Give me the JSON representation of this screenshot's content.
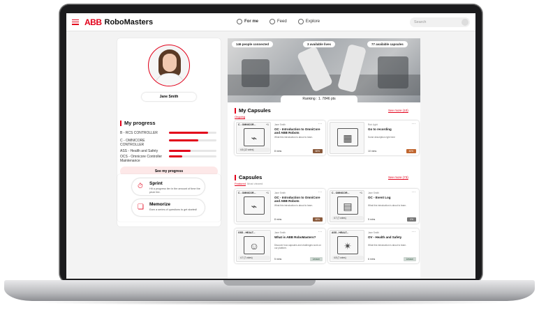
{
  "nav": {
    "logo": "ABB",
    "app_name": "RoboMasters",
    "tabs": [
      {
        "label": "For me",
        "active": true
      },
      {
        "label": "Feed",
        "active": false
      },
      {
        "label": "Explore",
        "active": false
      }
    ],
    "search_placeholder": "Search"
  },
  "profile": {
    "name": "Jane Smith",
    "progress_title": "My progress",
    "progress": [
      {
        "label": "B - RCS CONTROLLER",
        "value": 0.82
      },
      {
        "label": "C - OMNICORE CONTROLLER",
        "value": 0.62
      },
      {
        "label": "ASS - Health and Safety",
        "value": 0.45
      },
      {
        "label": "OCS - Omnicore Controller Maintenance",
        "value": 0.28
      }
    ],
    "see_progress": "See my progress"
  },
  "activities": [
    {
      "title": "Sprint",
      "desc": "Hit a progress tier in the amount of time the prize fee."
    },
    {
      "title": "Memorize",
      "desc": "Earn a series of questions to get started!"
    }
  ],
  "hero": {
    "connected": "146 people connected",
    "lives": "3 available lives",
    "capsules_avail": "77 available capsules",
    "ranking": "Ranking : 1.  7846 pts"
  },
  "my_capsules": {
    "title": "My Capsules",
    "see_more": "See more (10)",
    "tab": "Ongoing",
    "items": [
      {
        "code": "C - OMNICOR...",
        "count": "+1",
        "by": "Jane Smith",
        "title": "OC - Introduction to OmniCore and ABB Robots",
        "desc": "What this introduction is about to learn.",
        "rating": "4.6 (12 votes)",
        "time": "8 mins",
        "badge": "60%",
        "badge_color": "#8a5a3c",
        "symbol": "⌁"
      },
      {
        "code": "",
        "count": "",
        "by": "Rob Light",
        "title": "Go to recording",
        "desc": "Some description right here",
        "rating": "",
        "time": "10 mins",
        "badge": "40%",
        "badge_color": "#c0662f",
        "symbol": "▦"
      }
    ]
  },
  "capsules": {
    "title": "Capsules",
    "see_more": "See more (73)",
    "tabs": [
      {
        "label": "Featured",
        "active": true
      },
      {
        "label": "Most viewed",
        "active": false
      }
    ],
    "items": [
      {
        "code": "C - OMNICOR...",
        "count": "+1",
        "by": "Jane Smith",
        "title": "OC - Introduction to OmniCore and ABB Robots",
        "desc": "What this introduction is about to learn.",
        "rating": "",
        "time": "8 mins",
        "badge": "60%",
        "badge_color": "#8a5a3c",
        "symbol": "⌁"
      },
      {
        "code": "C - OMNICOR...",
        "count": "+1",
        "by": "Jane Smith",
        "title": "OC - Event Log",
        "desc": "What this introduction is about to learn.",
        "rating": "4.7 (7 votes)",
        "time": "5 mins",
        "badge": "0%",
        "badge_color": "#777777",
        "symbol": "▤"
      },
      {
        "code": "GSS - HEALT...",
        "count": "",
        "by": "Jane Smith",
        "title": "What is ABB RoboMasters?",
        "desc": "Discover how capsules and challenges work on our platform.",
        "rating": "4.7 (7 votes)",
        "time": "5 mins",
        "badge": "Lesson",
        "badge_color": "#cfd8d3",
        "symbol": "☺"
      },
      {
        "code": "ASS - HEALT...",
        "count": "",
        "by": "Jane Smith",
        "title": "OV - Health and Safety",
        "desc": "What this introduction is about to learn.",
        "rating": "4.8 (7 votes)",
        "time": "6 mins",
        "badge": "Lesson",
        "badge_color": "#cfd8d3",
        "symbol": "✴"
      }
    ]
  }
}
